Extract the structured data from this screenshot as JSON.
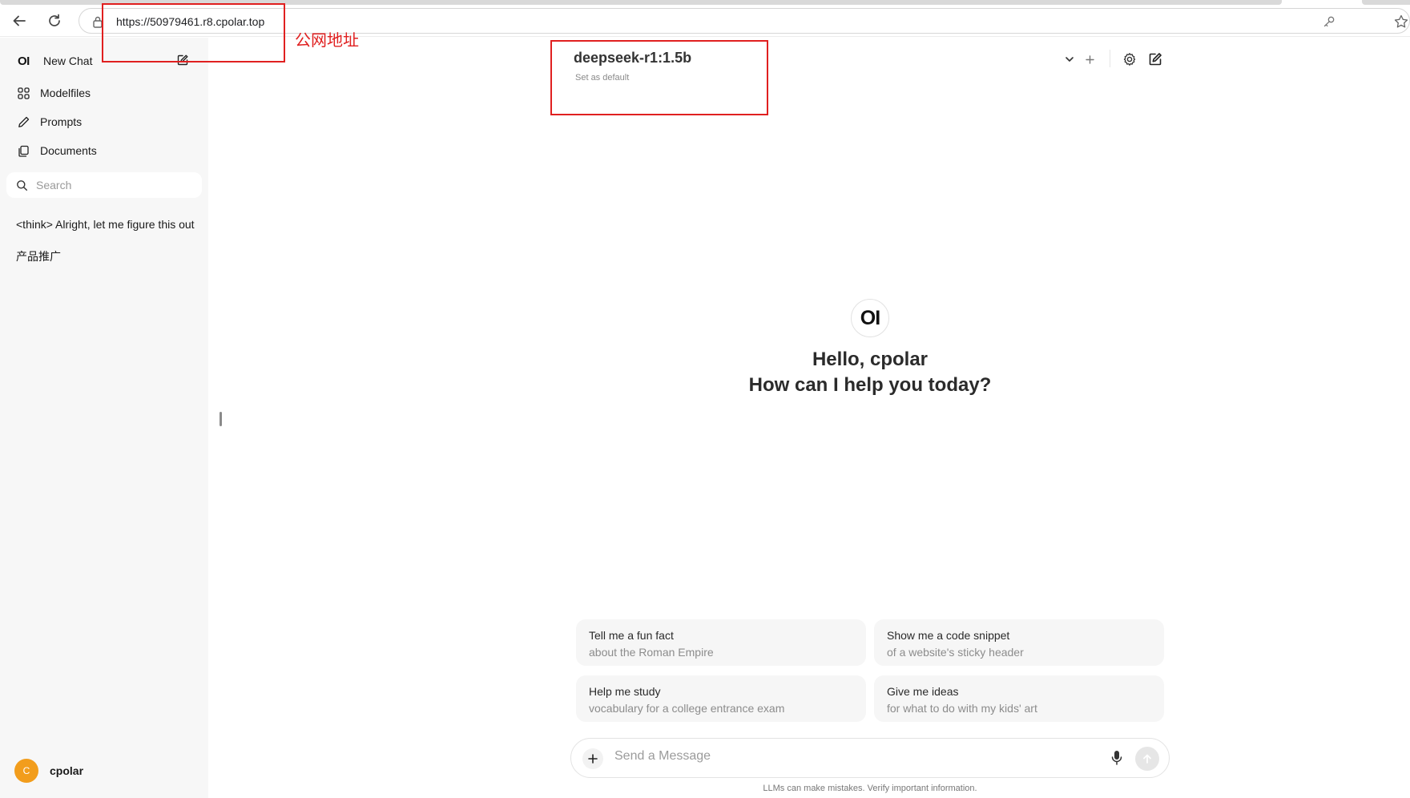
{
  "browser": {
    "url": "https://50979461.r8.cpolar.top"
  },
  "annotation": {
    "label": "公网地址",
    "color": "#e02020"
  },
  "sidebar": {
    "new_chat_label": "New Chat",
    "logo_text": "OI",
    "items": [
      {
        "label": "Modelfiles",
        "icon": "grid-icon"
      },
      {
        "label": "Prompts",
        "icon": "pencil-icon"
      },
      {
        "label": "Documents",
        "icon": "copy-icon"
      }
    ],
    "search_placeholder": "Search",
    "history": [
      "<think> Alright, let me figure this out",
      "产品推广"
    ],
    "user": {
      "avatar_letter": "C",
      "name": "cpolar",
      "avatar_color": "#f29d1c"
    }
  },
  "header": {
    "model_name": "deepseek-r1:1.5b",
    "set_default": "Set as default"
  },
  "main": {
    "logo_text": "OI",
    "greeting_line1": "Hello, cpolar",
    "greeting_line2": "How can I help you today?",
    "suggestions": [
      {
        "title": "Tell me a fun fact",
        "subtitle": "about the Roman Empire"
      },
      {
        "title": "Show me a code snippet",
        "subtitle": "of a website's sticky header"
      },
      {
        "title": "Help me study",
        "subtitle": "vocabulary for a college entrance exam"
      },
      {
        "title": "Give me ideas",
        "subtitle": "for what to do with my kids' art"
      }
    ],
    "input_placeholder": "Send a Message",
    "disclaimer": "LLMs can make mistakes. Verify important information."
  }
}
